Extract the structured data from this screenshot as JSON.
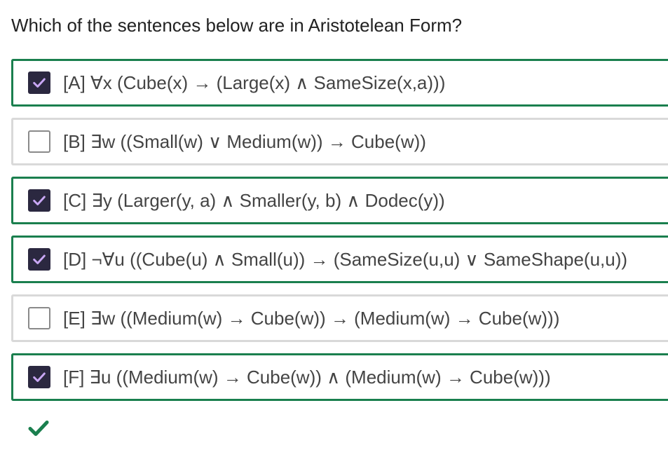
{
  "question": "Which of the sentences below are in Aristotelean Form?",
  "options": [
    {
      "label": "[A] ∀x (Cube(x) → (Large(x) ∧ SameSize(x,a)))",
      "checked": true
    },
    {
      "label": "[B] ∃w ((Small(w) ∨ Medium(w)) → Cube(w))",
      "checked": false
    },
    {
      "label": "[C] ∃y (Larger(y, a) ∧ Smaller(y, b) ∧ Dodec(y))",
      "checked": true
    },
    {
      "label": "[D] ¬∀u ((Cube(u) ∧ Small(u)) → (SameSize(u,u) ∨ SameShape(u,u))",
      "checked": true
    },
    {
      "label": "[E] ∃w ((Medium(w) → Cube(w)) → (Medium(w) → Cube(w)))",
      "checked": false
    },
    {
      "label": "[F] ∃u ((Medium(w) → Cube(w)) ∧ (Medium(w) → Cube(w)))",
      "checked": true
    }
  ],
  "result_icon": "checkmark-icon",
  "colors": {
    "selected_border": "#1a7f4e",
    "unselected_border": "#d9d9d9",
    "checkbox_fill": "#2b2840",
    "check_mark": "#c9a7f5",
    "correct_icon": "#1a7f4e"
  }
}
